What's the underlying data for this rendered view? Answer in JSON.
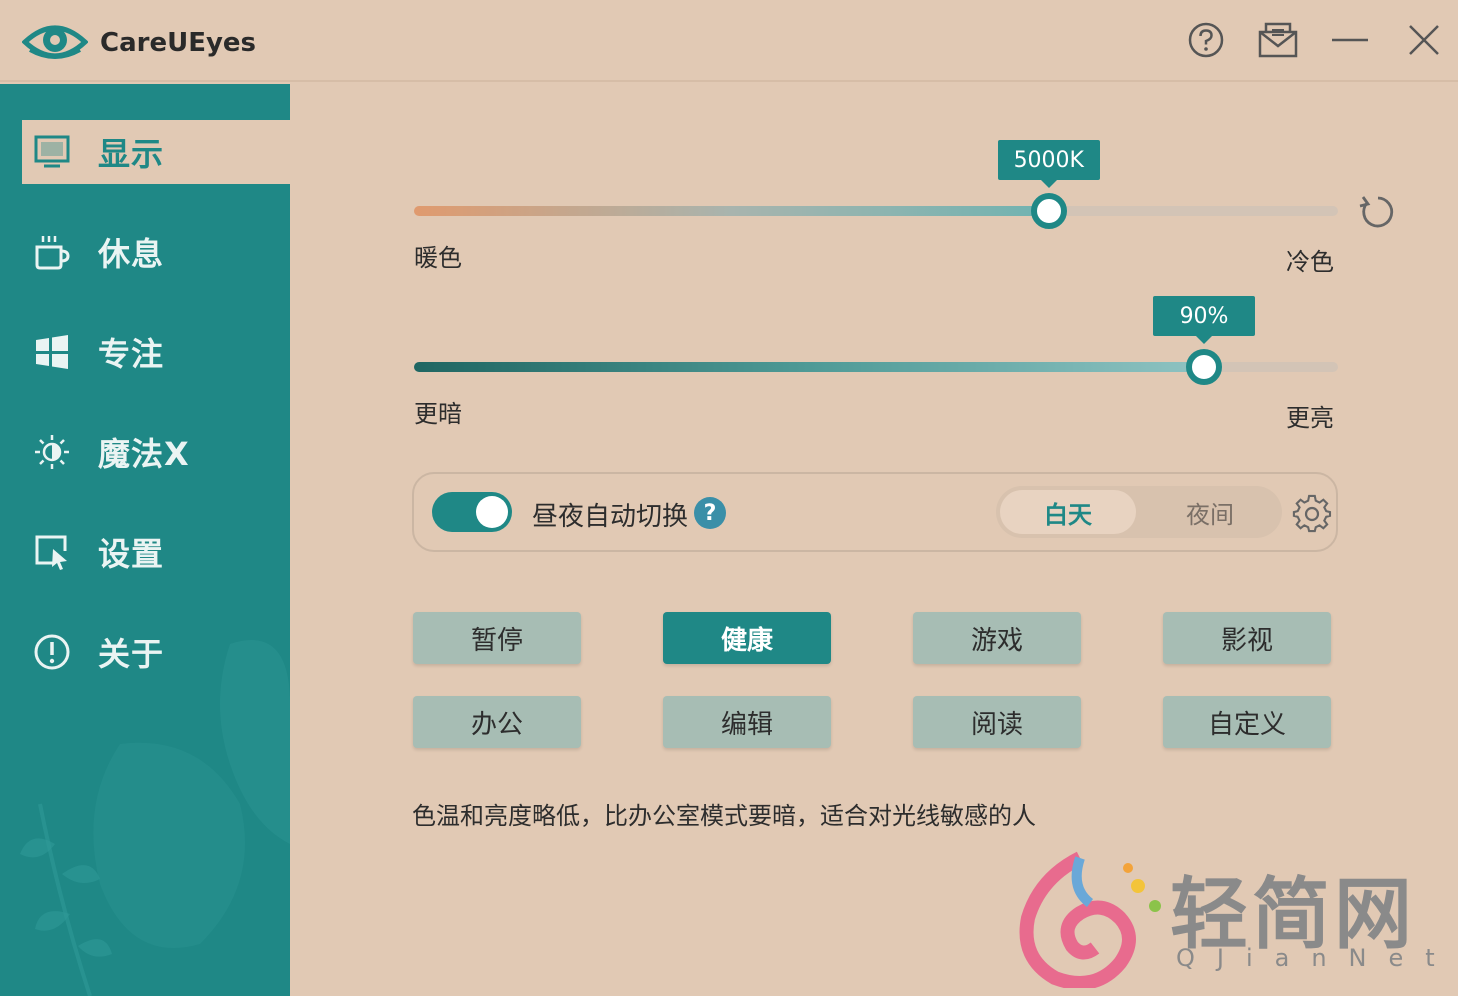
{
  "app": {
    "title": "CareUEyes"
  },
  "titlebar": {
    "buttons": [
      {
        "icon": "help-icon"
      },
      {
        "icon": "mail-icon"
      },
      {
        "icon": "minimize-icon"
      },
      {
        "icon": "close-icon"
      }
    ]
  },
  "sidebar": {
    "items": [
      {
        "label": "显示",
        "icon": "monitor-icon",
        "active": true
      },
      {
        "label": "休息",
        "icon": "coffee-cup-icon",
        "active": false
      },
      {
        "label": "专注",
        "icon": "windows-icon",
        "active": false
      },
      {
        "label": "魔法X",
        "icon": "sun-moon-icon",
        "active": false
      },
      {
        "label": "设置",
        "icon": "cursor-screen-icon",
        "active": false
      },
      {
        "label": "关于",
        "icon": "info-icon",
        "active": false
      }
    ]
  },
  "color_temp": {
    "value_label": "5000K",
    "fraction": 0.687,
    "min_label": "暖色",
    "max_label": "冷色"
  },
  "brightness": {
    "value_label": "90%",
    "fraction": 0.855,
    "min_label": "更暗",
    "max_label": "更亮"
  },
  "auto_switch": {
    "label": "昼夜自动切换",
    "help": "?",
    "enabled": true,
    "day_label": "白天",
    "night_label": "夜间",
    "selected": "白天"
  },
  "modes": [
    {
      "label": "暂停",
      "active": false
    },
    {
      "label": "健康",
      "active": true
    },
    {
      "label": "游戏",
      "active": false
    },
    {
      "label": "影视",
      "active": false
    },
    {
      "label": "办公",
      "active": false
    },
    {
      "label": "编辑",
      "active": false
    },
    {
      "label": "阅读",
      "active": false
    },
    {
      "label": "自定义",
      "active": false
    }
  ],
  "description": "色温和亮度略低，比办公室模式要暗，适合对光线敏感的人",
  "watermark": {
    "title": "轻简网",
    "subtitle": "QJianNet"
  },
  "colors": {
    "accent": "#1f8886",
    "background": "#e1c9b4",
    "mode_button": "#a7bdb4"
  }
}
